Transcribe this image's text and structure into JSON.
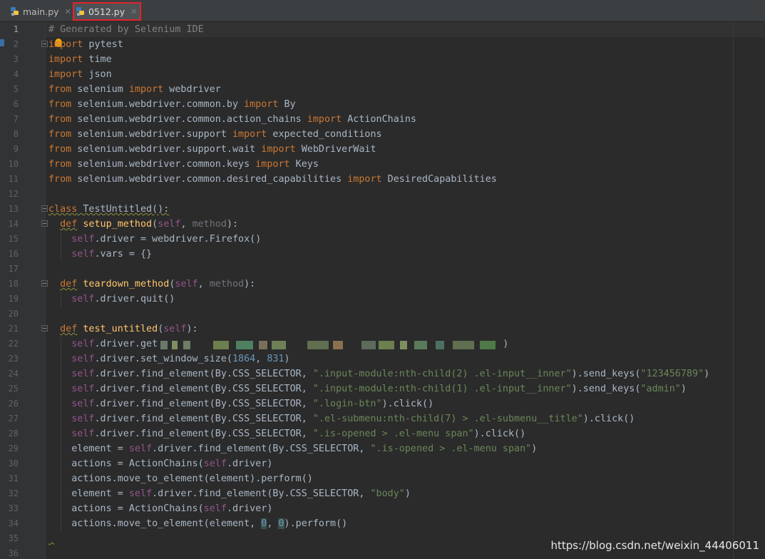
{
  "tabs": [
    {
      "label": "main.py",
      "icon": "python-file-icon",
      "active": false
    },
    {
      "label": "0512.py",
      "icon": "python-file-icon",
      "active": true
    }
  ],
  "current_line": 1,
  "line_numbers": [
    "1",
    "2",
    "3",
    "4",
    "5",
    "6",
    "7",
    "8",
    "9",
    "10",
    "11",
    "12",
    "13",
    "14",
    "15",
    "16",
    "17",
    "18",
    "19",
    "20",
    "21",
    "22",
    "23",
    "24",
    "25",
    "26",
    "27",
    "28",
    "29",
    "30",
    "31",
    "32",
    "33",
    "34",
    "35",
    "36"
  ],
  "code": {
    "l1": {
      "comment": "# Generated by Selenium IDE"
    },
    "l2": {
      "kw1": "import",
      "rest": " pytest"
    },
    "l3": {
      "kw1": "import",
      "rest": " time"
    },
    "l4": {
      "kw1": "import",
      "rest": " json"
    },
    "l5": {
      "kw1": "from",
      "mod": " selenium ",
      "kw2": "import",
      "rest": " webdriver"
    },
    "l6": {
      "kw1": "from",
      "mod": " selenium.webdriver.common.by ",
      "kw2": "import",
      "rest": " By"
    },
    "l7": {
      "kw1": "from",
      "mod": " selenium.webdriver.common.action_chains ",
      "kw2": "import",
      "rest": " ActionChains"
    },
    "l8": {
      "kw1": "from",
      "mod": " selenium.webdriver.support ",
      "kw2": "import",
      "rest": " expected_conditions"
    },
    "l9": {
      "kw1": "from",
      "mod": " selenium.webdriver.support.wait ",
      "kw2": "import",
      "rest": " WebDriverWait"
    },
    "l10": {
      "kw1": "from",
      "mod": " selenium.webdriver.common.keys ",
      "kw2": "import",
      "rest": " Keys"
    },
    "l11": {
      "kw1": "from",
      "mod": " selenium.webdriver.common.desired_capabilities ",
      "kw2": "import",
      "rest": " DesiredCapabilities"
    },
    "l13": {
      "kw": "class",
      "name": " TestUntitled",
      "rest": "():"
    },
    "l14": {
      "kw": "def",
      "fn": "setup_method",
      "p1": "self",
      "sep": ", ",
      "p2": "method",
      "end": "):"
    },
    "l15": {
      "self": "self",
      "rest": ".driver = webdriver.Firefox()"
    },
    "l16": {
      "self": "self",
      "rest": ".vars = {}"
    },
    "l18": {
      "kw": "def",
      "fn": "teardown_method",
      "p1": "self",
      "sep": ", ",
      "p2": "method",
      "end": "):"
    },
    "l19": {
      "self": "self",
      "rest": ".driver.quit()"
    },
    "l21": {
      "kw": "def",
      "fn": "test_untitled",
      "p1": "self",
      "end": "):"
    },
    "l22": {
      "self": "self",
      "rest": ".driver.get",
      "end": ")"
    },
    "l23": {
      "self": "self",
      "rest": ".driver.set_window_size(",
      "n1": "1864",
      "sep": ", ",
      "n2": "831",
      "end": ")"
    },
    "l24": {
      "self": "self",
      "rest": ".driver.find_element(By.CSS_SELECTOR, ",
      "s1": "\".input-module:nth-child(2) .el-input__inner\"",
      "mid": ").send_keys(",
      "s2": "\"123456789\"",
      "end": ")"
    },
    "l25": {
      "self": "self",
      "rest": ".driver.find_element(By.CSS_SELECTOR, ",
      "s1": "\".input-module:nth-child(1) .el-input__inner\"",
      "mid": ").send_keys(",
      "s2": "\"admin\"",
      "end": ")"
    },
    "l26": {
      "self": "self",
      "rest": ".driver.find_element(By.CSS_SELECTOR, ",
      "s1": "\".login-btn\"",
      "end": ").click()"
    },
    "l27": {
      "self": "self",
      "rest": ".driver.find_element(By.CSS_SELECTOR, ",
      "s1": "\".el-submenu:nth-child(7) > .el-submenu__title\"",
      "end": ").click()"
    },
    "l28": {
      "self": "self",
      "rest": ".driver.find_element(By.CSS_SELECTOR, ",
      "s1": "\".is-opened > .el-menu span\"",
      "end": ").click()"
    },
    "l29": {
      "pre": "element = ",
      "self": "self",
      "rest": ".driver.find_element(By.CSS_SELECTOR, ",
      "s1": "\".is-opened > .el-menu span\"",
      "end": ")"
    },
    "l30": {
      "pre": "actions = ActionChains(",
      "self": "self",
      "end": ".driver)"
    },
    "l31": {
      "pre": "actions.move_to_element(element).perform()"
    },
    "l32": {
      "pre": "element = ",
      "self": "self",
      "rest": ".driver.find_element(By.CSS_SELECTOR, ",
      "s1": "\"body\"",
      "end": ")"
    },
    "l33": {
      "pre": "actions = ActionChains(",
      "self": "self",
      "end": ".driver)"
    },
    "l34": {
      "pre": "actions.move_to_element(element, ",
      "n1": "0",
      "sep": ", ",
      "n2": "0",
      "end": ").perform()"
    }
  },
  "watermark": "https://blog.csdn.net/weixin_44406011",
  "colors": {
    "background": "#2b2b2b",
    "keyword": "#cc7832",
    "string": "#6a8759",
    "number": "#6897bb",
    "self": "#94558d",
    "function": "#ffc66d",
    "comment": "#808080",
    "text": "#a9b7c6",
    "active_tab_border": "#e0242b"
  }
}
